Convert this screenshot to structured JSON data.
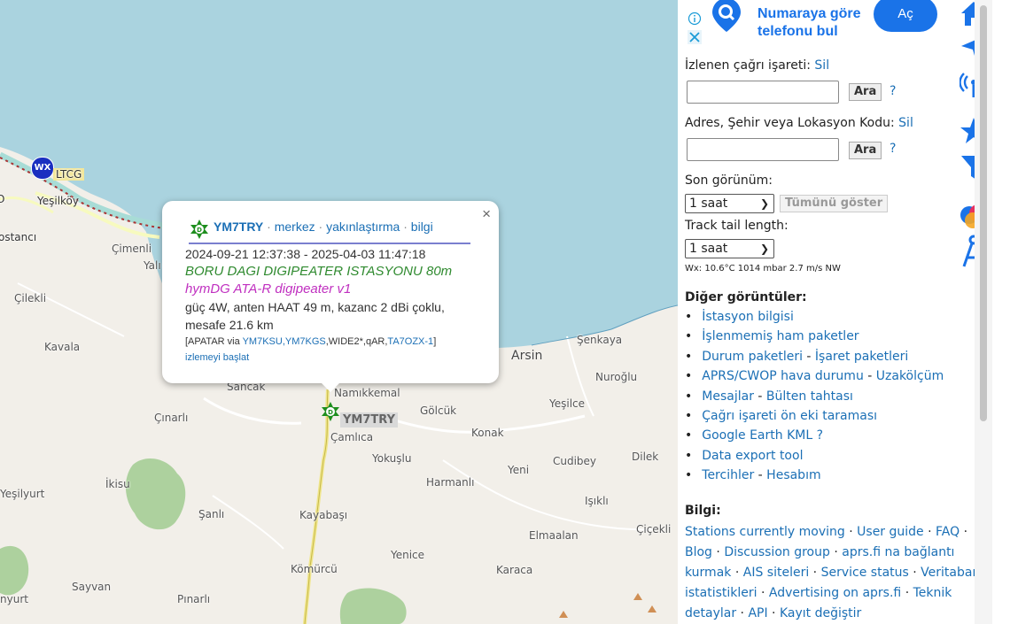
{
  "map": {
    "places": [
      "LTCG",
      "Yeşilköy",
      "ostancı",
      "Çimenli",
      "Yalı",
      "Çilekli",
      "Kavala",
      "Sancak",
      "Namıkkemal",
      "Çınarlı",
      "Gölcük",
      "Çamlıca",
      "Konak",
      "Yokuşlu",
      "Harmanlı",
      "Yeni",
      "Cudibey",
      "Dilek",
      "Yeşilyurt",
      "İkisu",
      "Işıklı",
      "Şanlı",
      "Kayabaşı",
      "Elmaalan",
      "Çiçekli",
      "Yenice",
      "Kömürcü",
      "Karaca",
      "Sayvan",
      "Pınarlı",
      "nyurt",
      "Şenkaya",
      "Nuroğlu",
      "Arsin",
      "Yeşilce",
      "O"
    ],
    "wx_badge": "WX",
    "station_label": "YM7TRY",
    "marker_letter": "D"
  },
  "popup": {
    "callsign": "YM7TRY",
    "link_center": "merkez",
    "link_zoom": "yakınlaştırma",
    "link_info": "bilgi",
    "separator": "·",
    "close": "×",
    "time_range": "2024-09-21 12:37:38 - 2025-04-03 11:47:18",
    "comment": "BORU DAGI DIGIPEATER ISTASYONU 80m",
    "device": "hymDG ATA-R digipeater v1",
    "phg": "güç 4W, anten HAAT 49 m, kazanc 2 dBi çoklu,",
    "distance": "mesafe 21.6 km",
    "path_prefix": "[APATAR via ",
    "path_links": "YM7KSU,YM7KGS",
    "path_mid": ",WIDE2*,qAR,",
    "path_gate": "TA7OZX-1",
    "path_suffix": "]",
    "track_link": "izlemeyi başlat"
  },
  "ad": {
    "text_line1": "Numaraya göre",
    "text_line2": "telefonu bul",
    "button": "Aç",
    "info_icon": "info-icon",
    "close_icon": "close-x-icon"
  },
  "sidebar": {
    "tracked_label": "İzlenen çağrı işareti:",
    "tracked_clear": "Sil",
    "search_button": "Ara",
    "help": "?",
    "address_label": "Adres, Şehir veya Lokasyon Kodu:",
    "address_clear": "Sil",
    "last_seen_label": "Son görünüm:",
    "last_seen_value": "1 saat",
    "show_all": "Tümünü göster",
    "track_tail_label": "Track tail length:",
    "track_tail_value": "1 saat",
    "wx": "Wx: 10.6°C 1014 mbar 2.7 m/s NW",
    "other_views_title": "Diğer görüntüler:",
    "other_views": [
      [
        "İstasyon bilgisi"
      ],
      [
        "İşlenmemiş ham paketler"
      ],
      [
        "Durum paketleri",
        "İşaret paketleri"
      ],
      [
        "APRS/CWOP hava durumu",
        "Uzaköl­çüm"
      ],
      [
        "Mesajlar",
        "Bülten tahtası"
      ],
      [
        "Çağrı işareti ön eki taraması"
      ],
      [
        "Google Earth KML",
        "?"
      ],
      [
        "Data export tool"
      ],
      [
        "Tercihler",
        "Hesabım"
      ]
    ],
    "info_title": "Bilgi:",
    "info_links": [
      "Stations currently moving",
      "User guide",
      "FAQ",
      "Blog",
      "Discussion group",
      "aprs.fi na bağlantı kurmak",
      "AIS siteleri",
      "Service status",
      "Veritabanı istatistikleri",
      "Advertising on aprs.fi",
      "Teknik detaylar",
      "API",
      "Kayıt değiştir"
    ]
  },
  "toolbar_icons": [
    "home-icon",
    "navigate-arrow-icon",
    "radio-antenna-icon",
    "star-icon",
    "filter-funnel-icon",
    "palette-icon",
    "compass-drafting-icon"
  ],
  "colors": {
    "sea": "#aad3df",
    "land": "#f2efe9",
    "accent": "#1b6fb5",
    "icon_blue": "#1a73e8"
  }
}
